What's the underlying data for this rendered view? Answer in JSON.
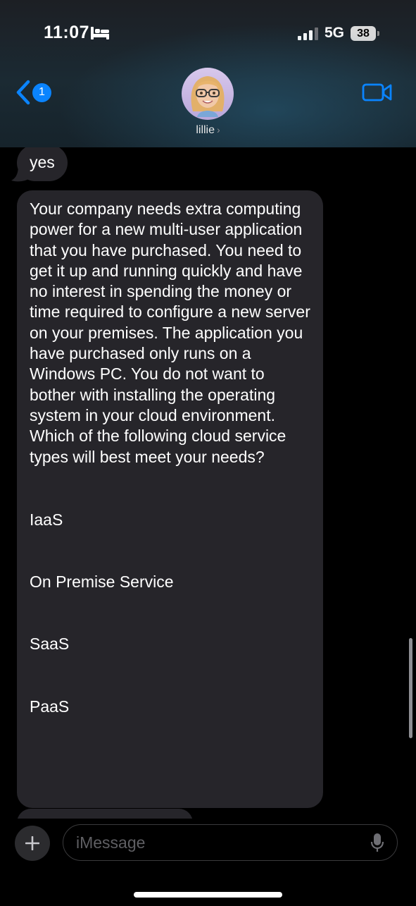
{
  "status_bar": {
    "time": "11:07",
    "network": "5G",
    "battery": "38",
    "icons": [
      "bed-icon",
      "signal-icon",
      "battery-icon"
    ]
  },
  "header": {
    "back_badge": "1",
    "contact_name": "lillie",
    "contact_chevron": "›",
    "icons": [
      "back-chevron-icon",
      "video-camera-icon"
    ]
  },
  "messages": [
    {
      "sender": "contact",
      "text": "yes"
    },
    {
      "sender": "contact",
      "text": "Your company needs extra computing power for a new multi-user application that you have purchased. You need to get it up and running quickly and have no interest in spending the money or time required to configure a new server on your premises. The application you have purchased only runs on a Windows PC. You do not want to bother with installing the operating system in your cloud environment.\nWhich of the following cloud service types will best meet your needs?",
      "options": [
        "IaaS",
        "On Premise Service",
        "SaaS",
        "PaaS"
      ]
    }
  ],
  "input_bar": {
    "placeholder": "iMessage",
    "icons": [
      "plus-icon",
      "microphone-icon"
    ]
  },
  "colors": {
    "accent": "#0a84ff",
    "bubble_received": "#26252a",
    "background": "#000000"
  }
}
